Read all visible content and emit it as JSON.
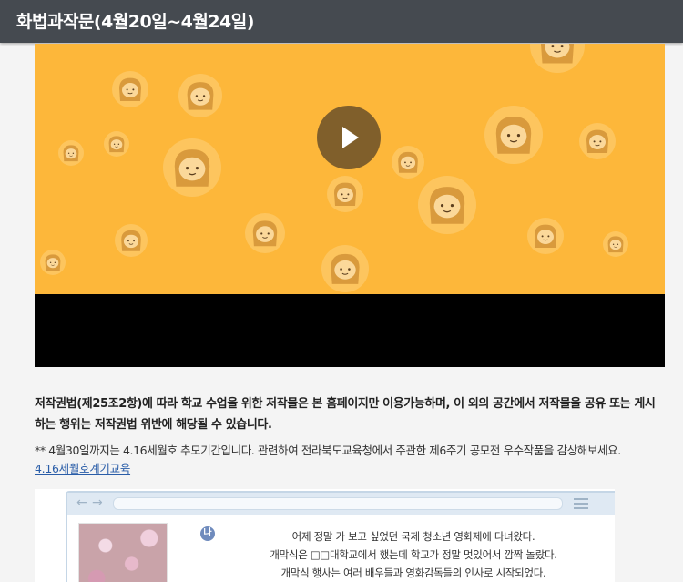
{
  "header": {
    "title": "화법과작문(4월20일~4월24일)"
  },
  "video": {
    "play_label": "▶"
  },
  "notice": {
    "text": "저작권법(제25조2항)에 따라 학교 수업을 위한 저작물은 본 홈페이지만 이용가능하며, 이 외의 공간에서 저작물을 공유 또는 게시하는 행위는 저작권법 위반에 해당될 수 있습니다."
  },
  "note": {
    "text": "** 4월30일까지는 4.16세월호 추모기간입니다. 관련하여 전라북도교육청에서 주관한 제6주기 공모전 우수작품을 감상해보세요."
  },
  "link": {
    "text": "4.16세월호계기교육"
  },
  "embedded_page": {
    "badge": "나",
    "lines": [
      "어제 정말 가 보고 싶었던 국제 청소년 영화제에 다녀왔다.",
      "개막식은 □□대학교에서 했는데 학교가 정말 멋있어서 깜짝 놀랐다.",
      "개막식 행사는 여러 배우들과 영화감독들의 인사로 시작되었다."
    ]
  },
  "colors": {
    "header_bg": "#454a50",
    "video_bg": "#fdb73a",
    "link": "#2a5da8"
  }
}
